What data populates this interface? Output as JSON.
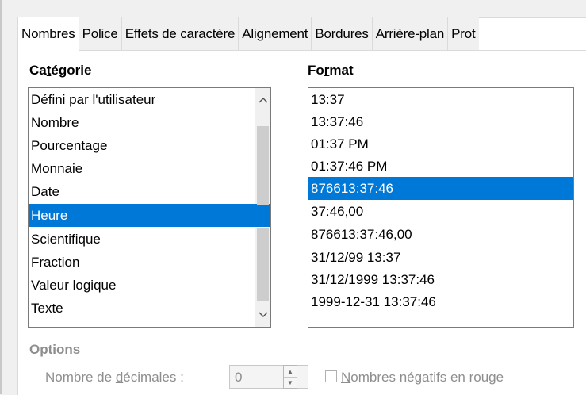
{
  "tabs": [
    {
      "label": "Nombres",
      "active": true
    },
    {
      "label": "Police",
      "active": false
    },
    {
      "label": "Effets de caractère",
      "active": false
    },
    {
      "label": "Alignement",
      "active": false
    },
    {
      "label": "Bordures",
      "active": false
    },
    {
      "label": "Arrière-plan",
      "active": false
    },
    {
      "label": "Prot",
      "active": false
    }
  ],
  "category": {
    "heading_pre": "Ca",
    "heading_mnemonic": "t",
    "heading_post": "égorie",
    "items": [
      "Défini par l'utilisateur",
      "Nombre",
      "Pourcentage",
      "Monnaie",
      "Date",
      "Heure",
      "Scientifique",
      "Fraction",
      "Valeur logique",
      "Texte"
    ],
    "selected": "Heure"
  },
  "format": {
    "heading_pre": "Fo",
    "heading_mnemonic": "r",
    "heading_post": "mat",
    "items": [
      "13:37",
      "13:37:46",
      "01:37 PM",
      "01:37:46 PM",
      "876613:37:46",
      "37:46,00",
      "876613:37:46,00",
      "31/12/99 13:37",
      "31/12/1999 13:37:46",
      "1999-12-31 13:37:46"
    ],
    "selected": "876613:37:46"
  },
  "options": {
    "heading": "Options",
    "decimals_label_pre": "Nombre de ",
    "decimals_label_mnemonic": "d",
    "decimals_label_post": "écimales :",
    "decimals_value": "0",
    "negative_red_mnemonic": "N",
    "negative_red_post": "ombres négatifs en rouge",
    "negative_red_checked": false
  },
  "colors": {
    "selection": "#0078d7",
    "disabled_text": "#8e8e8e"
  }
}
